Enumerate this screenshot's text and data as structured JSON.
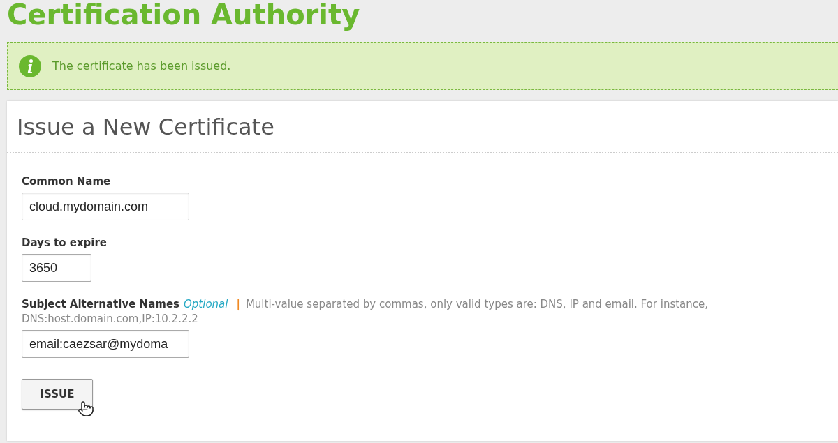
{
  "page_title": "Certification Authority",
  "message": {
    "kind": "info",
    "text": "The certificate has been issued."
  },
  "panel": {
    "title": "Issue a New Certificate",
    "fields": [
      {
        "label": "Common Name",
        "value": "cloud.mydomain.com"
      },
      {
        "label": "Days to expire",
        "value": "3650"
      },
      {
        "label": "Subject Alternative Names",
        "optional": "Optional",
        "separator": "|",
        "hint": "Multi-value separated by commas, only valid types are: DNS, IP and email. For instance, DNS:host.domain.com,IP:10.2.2.2",
        "value": "email:caezsar@mydoma"
      }
    ],
    "button": "ISSUE"
  }
}
